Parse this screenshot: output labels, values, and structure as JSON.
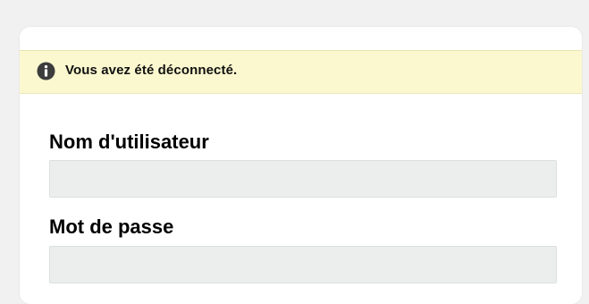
{
  "notice": {
    "icon": "info-icon",
    "text": "Vous avez été déconnecté.",
    "background": "#fbf8cf"
  },
  "form": {
    "username": {
      "label": "Nom d'utilisateur",
      "value": "",
      "placeholder": ""
    },
    "password": {
      "label": "Mot de passe",
      "value": "",
      "placeholder": ""
    }
  }
}
